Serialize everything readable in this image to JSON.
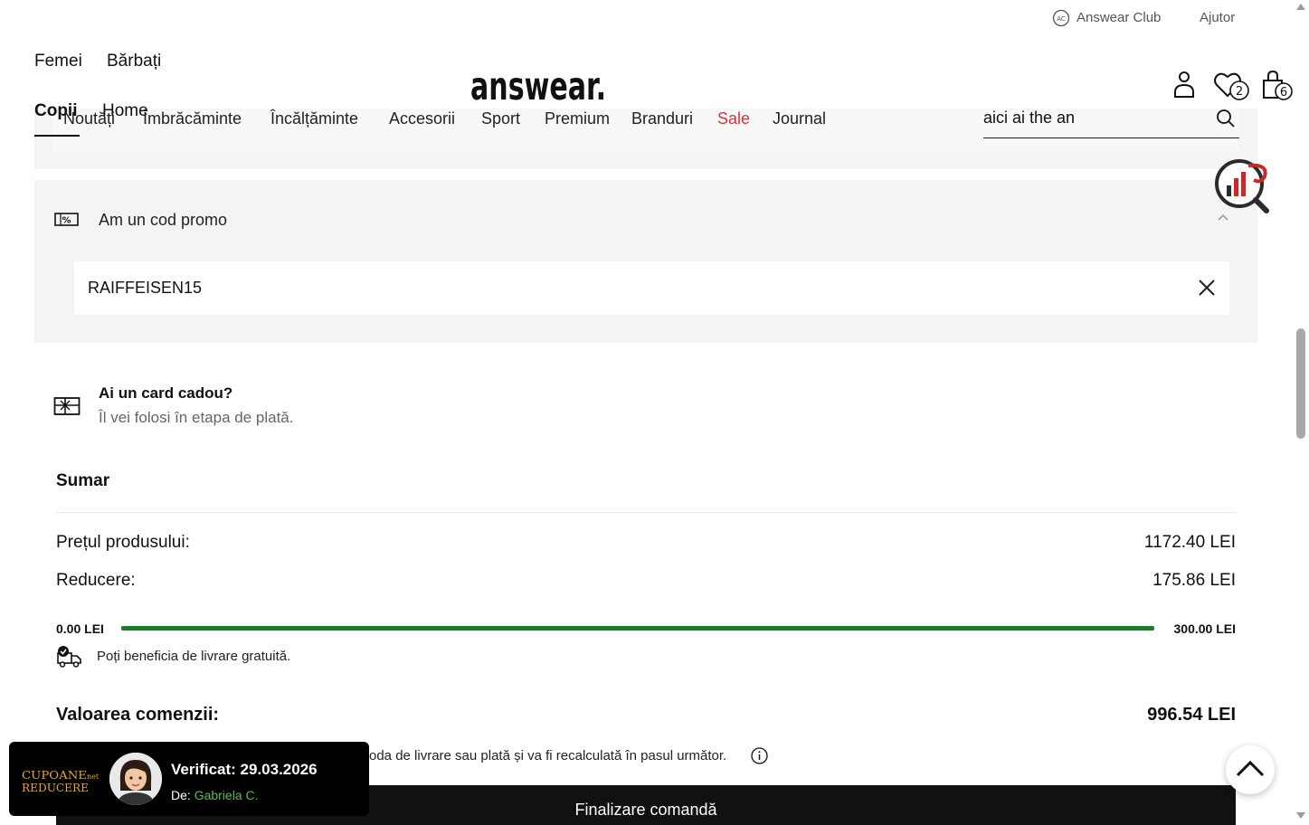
{
  "header": {
    "top_links": {
      "club": "Answear Club",
      "help": "Ajutor"
    },
    "genders": [
      "Femei",
      "Bărbați",
      "Copii",
      "Home"
    ],
    "categories": [
      "Noutăți",
      "Îmbrăcăminte",
      "Încălțăminte",
      "Accesorii",
      "Sport",
      "Premium",
      "Branduri",
      "Sale",
      "Journal"
    ],
    "logo": "answear.",
    "search_value": "aici ai the an",
    "wishlist_count": "2",
    "cart_count": "6",
    "sale_color": "#d4343a"
  },
  "promo": {
    "title": "Am un cod promo",
    "code": "RAIFFEISEN15"
  },
  "gift": {
    "title": "Ai un card cadou?",
    "subtitle": "Îl vei folosi în etapa de plată."
  },
  "summary": {
    "title": "Sumar",
    "product_price_label": "Prețul produsului:",
    "product_price_value": "1172.40 LEI",
    "discount_label": "Reducere:",
    "discount_value": "175.86 LEI",
    "shipping_min": "0.00 LEI",
    "shipping_max": "300.00 LEI",
    "shipping_progress_fraction": 1.0,
    "progress_color": "#1f7a2e",
    "free_shipping_text": "Poți beneficia de livrare gratuită.",
    "total_label": "Valoarea comenzii:",
    "total_value": "996.54 LEI",
    "note_partial": "oda de livrare sau plată și va fi recalculată în pasul următor.",
    "checkout_label": "Finalizare comandă"
  },
  "coupon_popup": {
    "logo_text": "CUPOANE REDUCERE",
    "logo_suffix": "net",
    "verified": "Verificat: 29.03.2026",
    "by_label": "De:",
    "by_name": "Gabriela C."
  }
}
